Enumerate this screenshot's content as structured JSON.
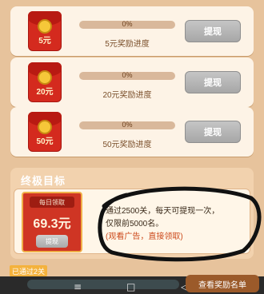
{
  "rewards": [
    {
      "amount_badge": "5元",
      "progress_percent": 0,
      "progress_text": "0%",
      "label": "5元奖励进度",
      "button": "提现"
    },
    {
      "amount_badge": "20元",
      "progress_percent": 0,
      "progress_text": "0%",
      "label": "20元奖励进度",
      "button": "提现"
    },
    {
      "amount_badge": "50元",
      "progress_percent": 0,
      "progress_text": "0%",
      "label": "50元奖励进度",
      "button": "提现"
    }
  ],
  "goal": {
    "title": "终极目标",
    "daily_caption": "每日领取",
    "daily_amount": "69.3元",
    "daily_button": "提现",
    "description_line1": "通过2500关，每天可提现一次，",
    "description_line2": "仅限前5000名。",
    "description_ad": "(观看广告，直接领取)"
  },
  "footer": {
    "passed_badge": "已通过2关",
    "reward_list_button": "查看奖励名单",
    "nav_icons": [
      "menu-icon",
      "home-square-icon",
      "back-arrow-icon"
    ],
    "nav_glyphs": [
      "≡",
      "□",
      "◁"
    ]
  },
  "colors": {
    "page_bg": "#e7c39c",
    "card_bg": "#fdf3e6",
    "progress_fill": "#7cc23b",
    "button_gray": "#a7a7a7",
    "packet_red": "#d42a1e",
    "ad_text": "#cc4a1c"
  }
}
